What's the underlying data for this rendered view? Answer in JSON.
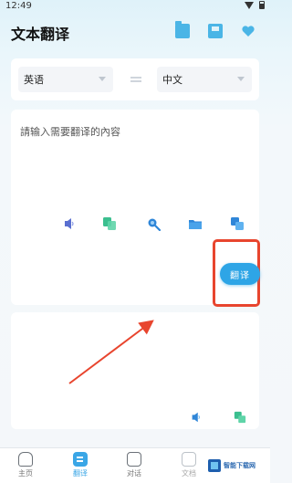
{
  "status_bar": {
    "time": "12:49"
  },
  "header": {
    "title": "文本翻译",
    "icons": [
      "folder-icon",
      "save-icon",
      "heart-icon"
    ]
  },
  "language_selector": {
    "source": "英语",
    "target": "中文"
  },
  "input": {
    "placeholder": "請输入需要翻译的內容",
    "tools": [
      "speaker-icon",
      "paste-icon",
      "search-icon",
      "folder-icon",
      "copy-icon"
    ]
  },
  "translate_button": {
    "label": "翻译"
  },
  "output": {
    "tools": [
      "speaker-icon",
      "copy-icon"
    ]
  },
  "tabbar": {
    "items": [
      {
        "label": "主页",
        "icon": "home-icon"
      },
      {
        "label": "翻译",
        "icon": "translate-icon",
        "active": true
      },
      {
        "label": "对话",
        "icon": "chat-icon"
      },
      {
        "label": "文档",
        "icon": "document-icon"
      }
    ]
  },
  "watermark": {
    "text": "智能下载网"
  },
  "colors": {
    "accent": "#2ea5e6",
    "highlight": "#e8452e"
  }
}
